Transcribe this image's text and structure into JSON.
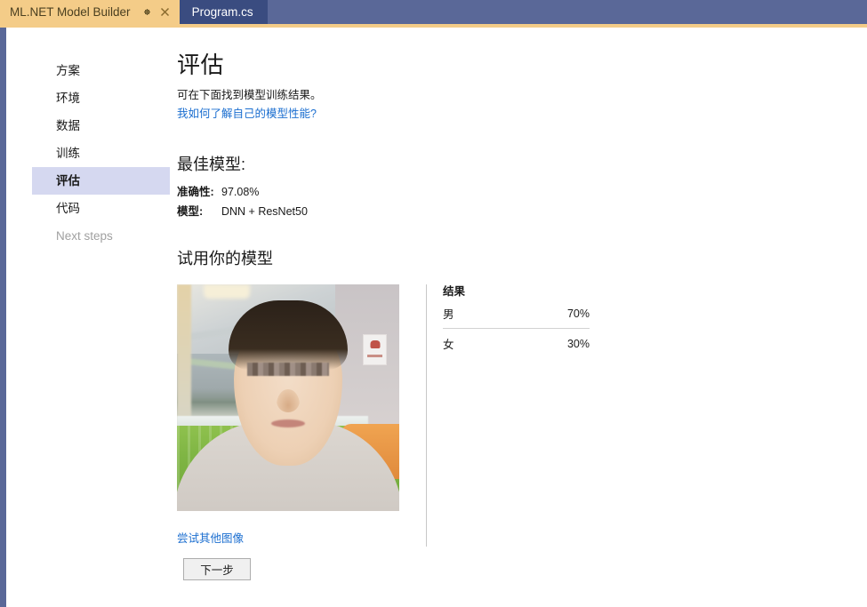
{
  "window": {
    "tabs": [
      {
        "label": "ML.NET Model Builder",
        "active": true,
        "pin_icon": "pin-icon",
        "close_icon": "close-icon"
      },
      {
        "label": "Program.cs",
        "active": false
      }
    ]
  },
  "sidebar": {
    "items": [
      {
        "label": "方案",
        "state": "normal"
      },
      {
        "label": "环境",
        "state": "normal"
      },
      {
        "label": "数据",
        "state": "normal"
      },
      {
        "label": "训练",
        "state": "normal"
      },
      {
        "label": "评估",
        "state": "selected"
      },
      {
        "label": "代码",
        "state": "normal"
      },
      {
        "label": "Next steps",
        "state": "disabled"
      }
    ]
  },
  "main": {
    "title": "评估",
    "subtitle": "可在下面找到模型训练结果。",
    "help_link": "我如何了解自己的模型性能?",
    "best_model_heading": "最佳模型:",
    "metrics": [
      {
        "label": "准确性:",
        "value": "97.08%"
      },
      {
        "label": "模型:",
        "value": "DNN + ResNet50"
      }
    ],
    "try_model_heading": "试用你的模型",
    "try_other_image_link": "尝试其他图像",
    "results": {
      "title": "结果",
      "rows": [
        {
          "label": "男",
          "value": "70%"
        },
        {
          "label": "女",
          "value": "30%"
        }
      ]
    },
    "next_button": "下一步"
  },
  "colors": {
    "tabbar_bg": "#5a6898",
    "active_tab_bg": "#f4cc88",
    "inactive_tab_bg": "#3a4c80",
    "selected_nav_bg": "#d5d8f0",
    "link": "#1c6fd0"
  }
}
